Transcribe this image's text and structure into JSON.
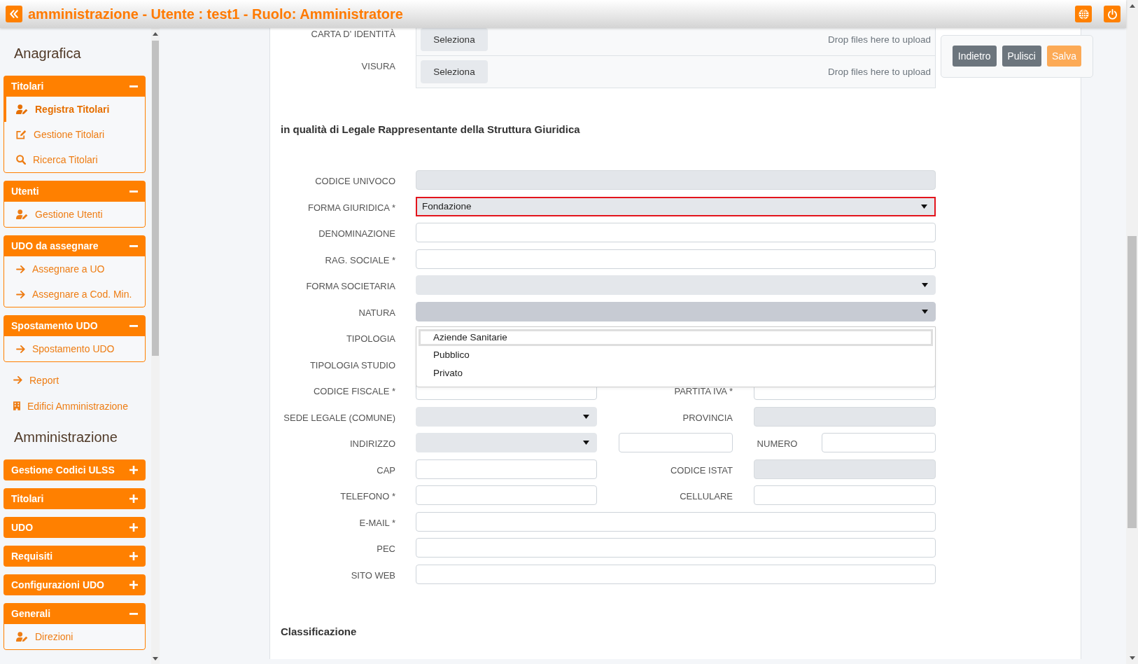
{
  "header": {
    "title": "amministrazione - Utente : test1 - Ruolo: Amministratore"
  },
  "sidebar": {
    "sections": [
      {
        "kind": "heading",
        "title": "Anagrafica"
      },
      {
        "kind": "panel",
        "title": "Titolari",
        "expanded": true,
        "items": [
          {
            "kind": "person",
            "label": "Registra Titolari",
            "selected": true
          },
          {
            "kind": "edit",
            "label": "Gestione Titolari",
            "selected": false
          },
          {
            "kind": "search",
            "label": "Ricerca Titolari",
            "selected": false
          }
        ]
      },
      {
        "kind": "panel",
        "title": "Utenti",
        "expanded": true,
        "items": [
          {
            "kind": "person",
            "label": "Gestione Utenti",
            "selected": false
          }
        ]
      },
      {
        "kind": "panel",
        "title": "UDO da assegnare",
        "expanded": true,
        "items": [
          {
            "kind": "arrow",
            "label": "Assegnare a UO",
            "selected": false
          },
          {
            "kind": "arrow",
            "label": "Assegnare a Cod. Min.",
            "selected": false
          }
        ]
      },
      {
        "kind": "panel",
        "title": "Spostamento UDO",
        "expanded": true,
        "items": [
          {
            "kind": "arrow",
            "label": "Spostamento UDO",
            "selected": false
          }
        ]
      },
      {
        "kind": "links",
        "items": [
          {
            "kind": "arrow",
            "label": "Report",
            "selected": false
          },
          {
            "kind": "building",
            "label": "Edifici Amministrazione",
            "selected": false
          }
        ]
      },
      {
        "kind": "heading",
        "title": "Amministrazione"
      },
      {
        "kind": "panel",
        "title": "Gestione Codici ULSS",
        "expanded": false
      },
      {
        "kind": "panel",
        "title": "Titolari",
        "expanded": false
      },
      {
        "kind": "panel",
        "title": "UDO",
        "expanded": false
      },
      {
        "kind": "panel",
        "title": "Requisiti",
        "expanded": false
      },
      {
        "kind": "panel",
        "title": "Configurazioni UDO",
        "expanded": false
      },
      {
        "kind": "panel",
        "title": "Generali",
        "expanded": true,
        "items": [
          {
            "kind": "person",
            "label": "Direzioni",
            "selected": false
          }
        ]
      }
    ]
  },
  "uploads": [
    {
      "label": "CARTA D' IDENTITÀ",
      "button": "Seleziona",
      "hint": "Drop files here to upload"
    },
    {
      "label": "VISURA",
      "button": "Seleziona",
      "hint": "Drop files here to upload"
    }
  ],
  "actions": [
    {
      "kind": "back",
      "label": "Indietro",
      "disabled": false
    },
    {
      "kind": "clear",
      "label": "Pulisci",
      "disabled": false
    },
    {
      "kind": "save",
      "label": "Salva",
      "disabled": true
    }
  ],
  "form": {
    "title": "in qualità di Legale Rappresentante della Struttura Giuridica",
    "rows": [
      {
        "kind": "single",
        "label": "CODICE UNIVOCO",
        "field": {
          "kind": "text",
          "disabled": true,
          "invalid": false
        }
      },
      {
        "kind": "single",
        "label": "FORMA GIURIDICA *",
        "field": {
          "kind": "select",
          "value": "Fondazione",
          "invalid": true,
          "expanded": false
        }
      },
      {
        "kind": "single",
        "label": "DENOMINAZIONE",
        "field": {
          "kind": "text",
          "disabled": false,
          "invalid": false
        }
      },
      {
        "kind": "single",
        "label": "RAG. SOCIALE *",
        "field": {
          "kind": "text",
          "disabled": false,
          "invalid": false
        }
      },
      {
        "kind": "single",
        "label": "FORMA SOCIETARIA",
        "field": {
          "kind": "select",
          "invalid": false,
          "expanded": false
        }
      },
      {
        "kind": "single",
        "label": "NATURA",
        "field": {
          "kind": "select",
          "invalid": false,
          "expanded": true,
          "options": [
            {
              "label": "Aziende Sanitarie",
              "selected": true
            },
            {
              "label": "Pubblico",
              "selected": false
            },
            {
              "label": "Privato",
              "selected": false
            }
          ]
        }
      },
      {
        "kind": "single",
        "label": "TIPOLOGIA"
      },
      {
        "kind": "single",
        "label": "TIPOLOGIA STUDIO"
      },
      {
        "kind": "pair",
        "label": "CODICE FISCALE *",
        "field": {
          "kind": "text",
          "disabled": false,
          "invalid": false
        },
        "label_2": "PARTITA IVA *",
        "field_2": {
          "kind": "text",
          "disabled": false,
          "invalid": false
        }
      },
      {
        "kind": "pair",
        "label": "SEDE LEGALE (COMUNE)",
        "field": {
          "kind": "select",
          "invalid": false,
          "expanded": false
        },
        "label_2": "PROVINCIA",
        "field_2": {
          "kind": "text",
          "disabled": true,
          "invalid": false
        }
      },
      {
        "kind": "address",
        "label": "INDIRIZZO",
        "field": {
          "kind": "select",
          "invalid": false,
          "expanded": false
        },
        "field_2": {
          "kind": "text",
          "disabled": false,
          "invalid": false
        },
        "label_2": "NUMERO",
        "field_3": {
          "kind": "text",
          "disabled": false,
          "invalid": false
        }
      },
      {
        "kind": "pair",
        "label": "CAP",
        "field": {
          "kind": "text",
          "disabled": false,
          "invalid": false
        },
        "label_2": "CODICE ISTAT",
        "field_2": {
          "kind": "text",
          "disabled": true,
          "invalid": false
        }
      },
      {
        "kind": "pair",
        "label": "TELEFONO *",
        "field": {
          "kind": "text",
          "disabled": false,
          "invalid": false
        },
        "label_2": "CELLULARE",
        "field_2": {
          "kind": "text",
          "disabled": false,
          "invalid": false
        }
      },
      {
        "kind": "single",
        "label": "E-MAIL *",
        "field": {
          "kind": "text",
          "disabled": false,
          "invalid": false
        }
      },
      {
        "kind": "single",
        "label": "PEC",
        "field": {
          "kind": "text",
          "disabled": false,
          "invalid": false
        }
      },
      {
        "kind": "single",
        "label": "SITO WEB",
        "field": {
          "kind": "text",
          "disabled": false,
          "invalid": false
        }
      }
    ]
  },
  "classification": {
    "title": "Classificazione"
  }
}
